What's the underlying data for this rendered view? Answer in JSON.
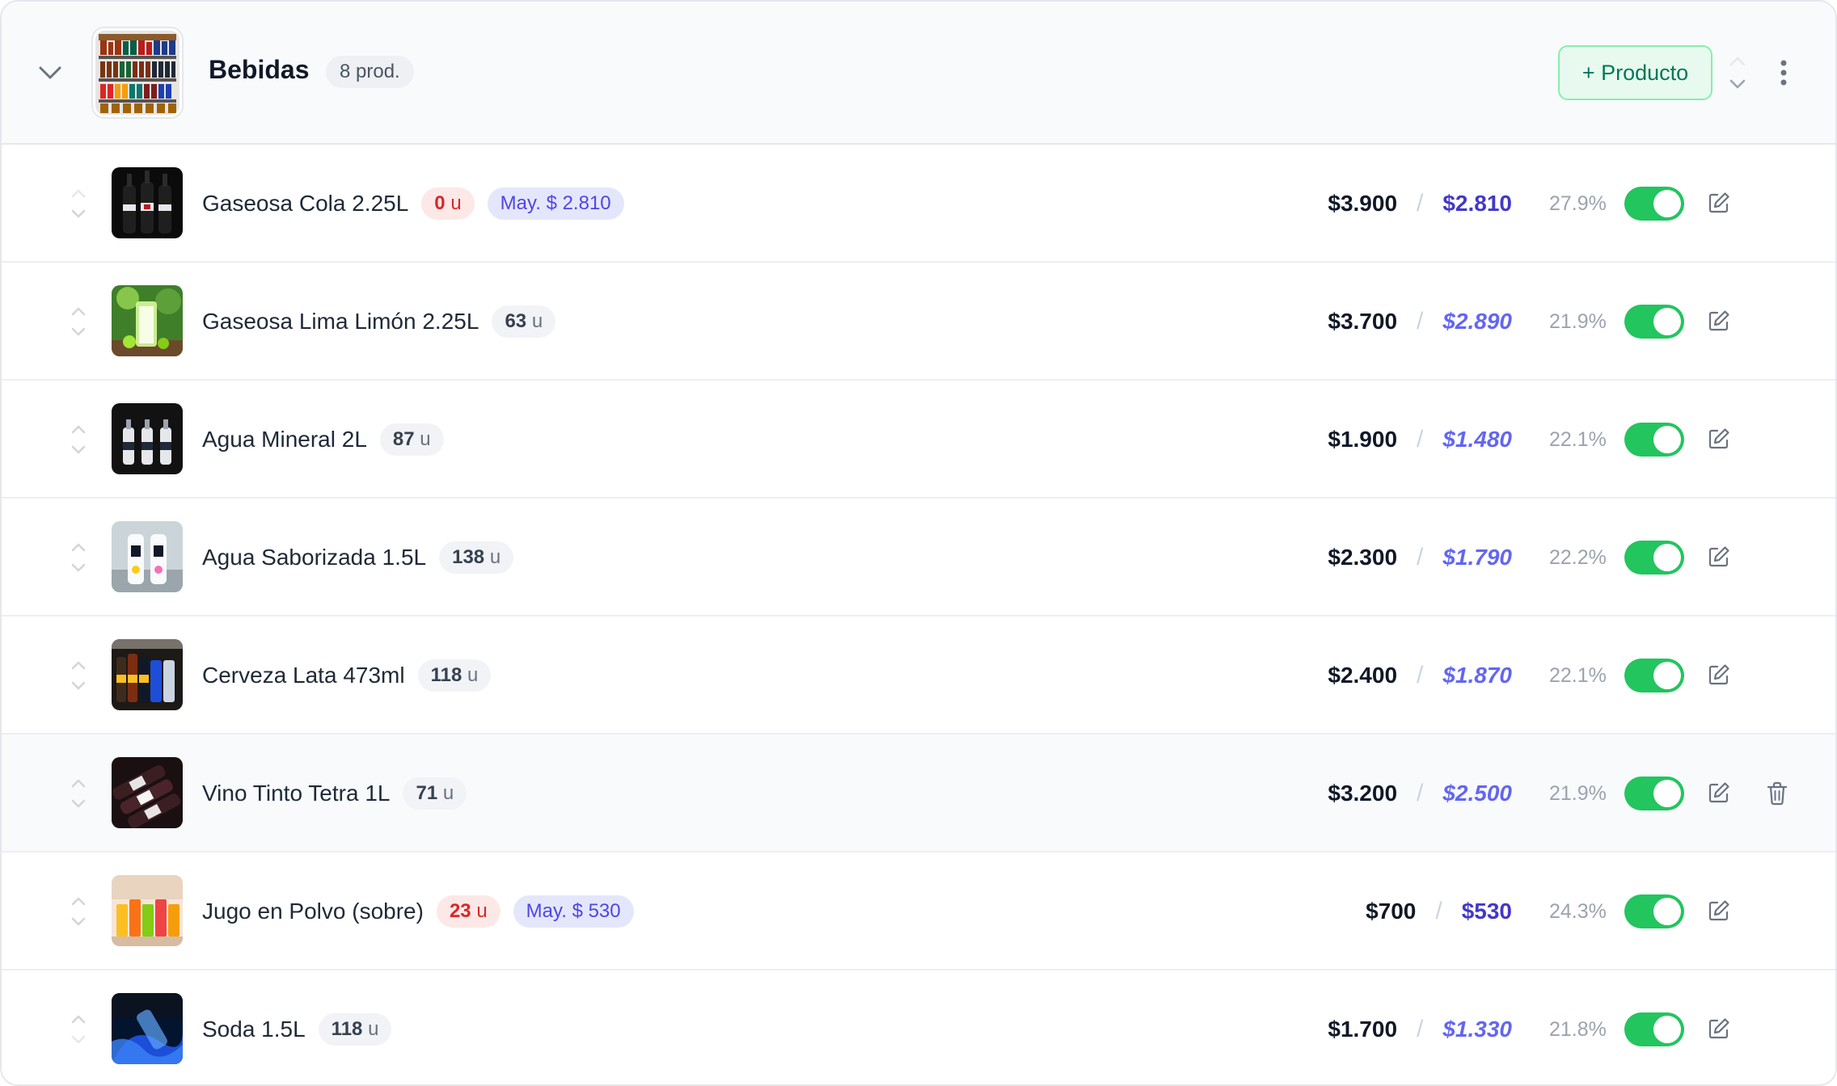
{
  "category": {
    "title": "Bebidas",
    "count": "8 prod.",
    "add_label": "+ Producto"
  },
  "products": [
    {
      "name": "Gaseosa Cola 2.25L",
      "stock_num": "0",
      "stock_unit": "u",
      "stock_low": true,
      "wholesale": "May. $ 2.810",
      "price": "$3.900",
      "separator": "/",
      "wholesale_price": "$2.810",
      "wholesale_italic": false,
      "margin": "27.9%",
      "active": true
    },
    {
      "name": "Gaseosa Lima Limón 2.25L",
      "stock_num": "63",
      "stock_unit": "u",
      "stock_low": false,
      "wholesale": null,
      "price": "$3.700",
      "separator": "/",
      "wholesale_price": "$2.890",
      "wholesale_italic": true,
      "margin": "21.9%",
      "active": true
    },
    {
      "name": "Agua Mineral 2L",
      "stock_num": "87",
      "stock_unit": "u",
      "stock_low": false,
      "wholesale": null,
      "price": "$1.900",
      "separator": "/",
      "wholesale_price": "$1.480",
      "wholesale_italic": true,
      "margin": "22.1%",
      "active": true
    },
    {
      "name": "Agua Saborizada 1.5L",
      "stock_num": "138",
      "stock_unit": "u",
      "stock_low": false,
      "wholesale": null,
      "price": "$2.300",
      "separator": "/",
      "wholesale_price": "$1.790",
      "wholesale_italic": true,
      "margin": "22.2%",
      "active": true
    },
    {
      "name": "Cerveza Lata 473ml",
      "stock_num": "118",
      "stock_unit": "u",
      "stock_low": false,
      "wholesale": null,
      "price": "$2.400",
      "separator": "/",
      "wholesale_price": "$1.870",
      "wholesale_italic": true,
      "margin": "22.1%",
      "active": true
    },
    {
      "name": "Vino Tinto Tetra 1L",
      "stock_num": "71",
      "stock_unit": "u",
      "stock_low": false,
      "wholesale": null,
      "price": "$3.200",
      "separator": "/",
      "wholesale_price": "$2.500",
      "wholesale_italic": true,
      "margin": "21.9%",
      "active": true,
      "hover": true
    },
    {
      "name": "Jugo en Polvo (sobre)",
      "stock_num": "23",
      "stock_unit": "u",
      "stock_low": true,
      "wholesale": "May. $ 530",
      "price": "$700",
      "separator": "/",
      "wholesale_price": "$530",
      "wholesale_italic": false,
      "margin": "24.3%",
      "active": true
    },
    {
      "name": "Soda 1.5L",
      "stock_num": "118",
      "stock_unit": "u",
      "stock_low": false,
      "wholesale": null,
      "price": "$1.700",
      "separator": "/",
      "wholesale_price": "$1.330",
      "wholesale_italic": true,
      "margin": "21.8%",
      "active": true
    }
  ],
  "icons": {
    "collapse": "chevron-down-icon",
    "sort": "sort-arrows-icon",
    "more": "more-vertical-icon",
    "edit": "edit-icon",
    "delete": "trash-icon"
  },
  "colors": {
    "accent_green": "#22c55e",
    "wholesale_indigo": "#4f46e5",
    "stock_low_red": "#dc2626"
  }
}
